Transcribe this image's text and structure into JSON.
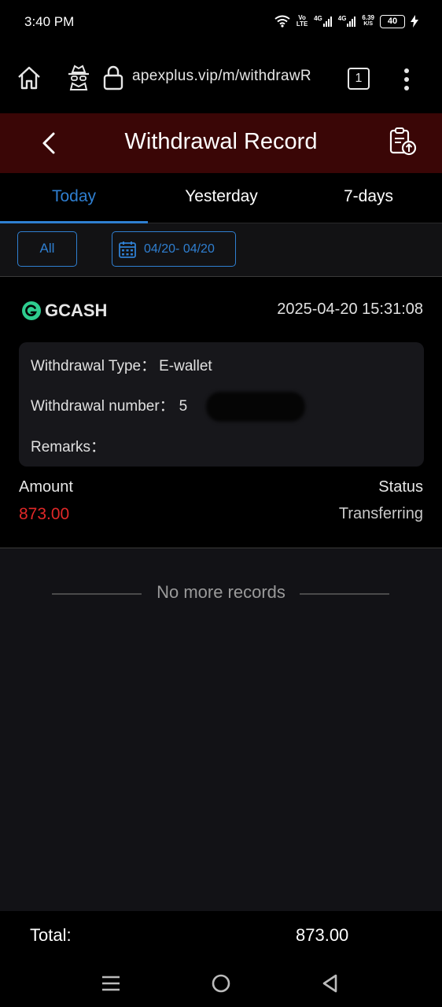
{
  "status_bar": {
    "time": "3:40 PM",
    "volte": "Vo LTE",
    "net1": "4G",
    "net2": "4G",
    "speed": "6.39",
    "speed_unit": "K/S",
    "battery": "40"
  },
  "browser": {
    "url": "apexplus.vip/m/withdrawR",
    "tab_count": "1"
  },
  "header": {
    "title": "Withdrawal Record"
  },
  "tabs": [
    {
      "label": "Today",
      "active": true
    },
    {
      "label": "Yesterday",
      "active": false
    },
    {
      "label": "7-days",
      "active": false
    }
  ],
  "filters": {
    "all_label": "All",
    "date_range": "04/20- 04/20"
  },
  "record": {
    "method": "GCASH",
    "datetime": "2025-04-20 15:31:08",
    "type_label": "Withdrawal Type：",
    "type_value": "E-wallet",
    "number_label": "Withdrawal number：",
    "number_value": "5",
    "remarks_label": "Remarks：",
    "remarks_value": "",
    "amount_label": "Amount",
    "amount_value": "873.00",
    "status_label": "Status",
    "status_value": "Transferring"
  },
  "empty_message": "No more records",
  "footer": {
    "total_label": "Total:",
    "total_value": "873.00"
  },
  "colors": {
    "accent": "#2f7fd1",
    "header_bg": "#3a0606",
    "amount": "#e02828",
    "gcash": "#2ecc8f"
  }
}
